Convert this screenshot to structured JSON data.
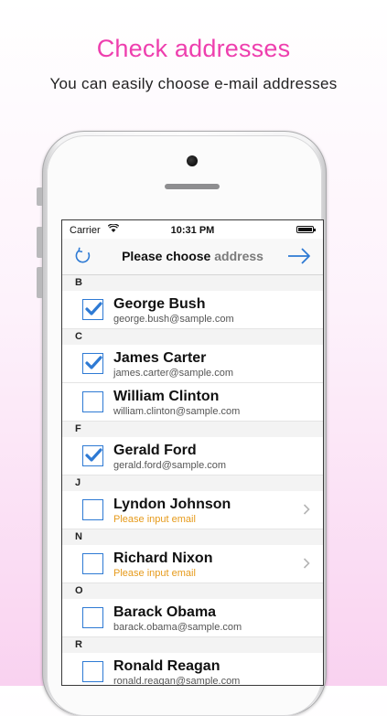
{
  "header": {
    "title": "Check addresses",
    "subtitle": "You can easily choose e-mail addresses"
  },
  "status": {
    "carrier": "Carrier",
    "time": "10:31 PM"
  },
  "nav": {
    "title_main": "Please choose ",
    "title_light": "address",
    "accent_color": "#2e7ad4"
  },
  "sections": [
    {
      "letter": "B",
      "contacts": [
        {
          "name": "George Bush",
          "email": "george.bush@sample.com",
          "checked": true,
          "warn": false
        }
      ]
    },
    {
      "letter": "C",
      "contacts": [
        {
          "name": "James Carter",
          "email": "james.carter@sample.com",
          "checked": true,
          "warn": false
        },
        {
          "name": "William Clinton",
          "email": "william.clinton@sample.com",
          "checked": false,
          "warn": false
        }
      ]
    },
    {
      "letter": "F",
      "contacts": [
        {
          "name": "Gerald Ford",
          "email": "gerald.ford@sample.com",
          "checked": true,
          "warn": false
        }
      ]
    },
    {
      "letter": "J",
      "contacts": [
        {
          "name": "Lyndon Johnson",
          "email": "Please input email",
          "checked": false,
          "warn": true
        }
      ]
    },
    {
      "letter": "N",
      "contacts": [
        {
          "name": "Richard Nixon",
          "email": "Please input email",
          "checked": false,
          "warn": true
        }
      ]
    },
    {
      "letter": "O",
      "contacts": [
        {
          "name": "Barack Obama",
          "email": "barack.obama@sample.com",
          "checked": false,
          "warn": false
        }
      ]
    },
    {
      "letter": "R",
      "contacts": [
        {
          "name": "Ronald Reagan",
          "email": "ronald.reagan@sample.com",
          "checked": false,
          "warn": false
        }
      ]
    }
  ]
}
